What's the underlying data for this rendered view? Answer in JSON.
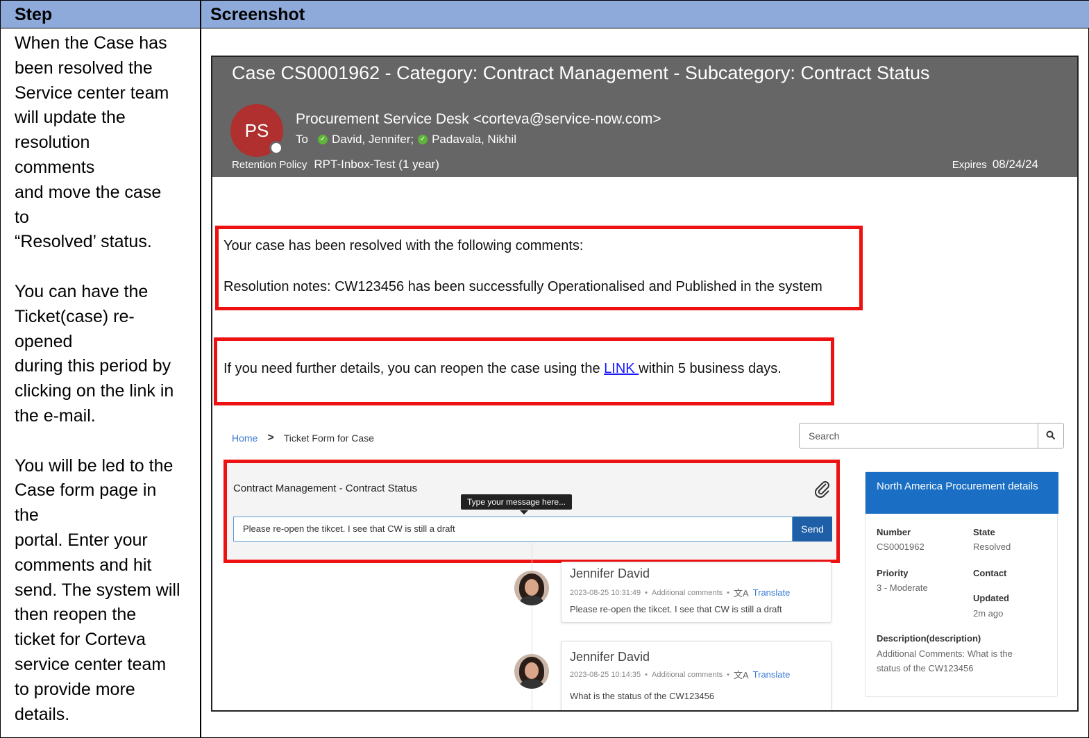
{
  "table": {
    "header_step": "Step",
    "header_screenshot": "Screenshot"
  },
  "step_text": {
    "para1": [
      "When the Case has",
      "been resolved the",
      "Service center team",
      "will update the",
      "resolution",
      "comments",
      "and move the case",
      "to",
      "“Resolved’ status."
    ],
    "para2": [
      "You can have the",
      "Ticket(case) re-",
      "opened",
      "during this period by",
      "clicking on the link in",
      "the e-mail."
    ],
    "para3": [
      "You will be led to the",
      "Case form page in",
      "the",
      "portal. Enter your",
      "comments and hit",
      "send. The system will",
      "then reopen the",
      "ticket for Corteva",
      "service center team",
      "to provide more",
      "details."
    ]
  },
  "email": {
    "subject": "Case CS0001962 - Category: Contract Management - Subcategory: Contract Status",
    "avatar_initials": "PS",
    "sender": "Procurement Service Desk <corteva@service-now.com>",
    "to_label": "To",
    "recipient_1": "David, Jennifer;",
    "recipient_2": "Padavala, Nikhil",
    "retention_label": "Retention Policy",
    "retention_value": "RPT-Inbox-Test (1 year)",
    "expires_label": "Expires",
    "expires_value": "08/24/24",
    "resolved_line": "Your case has been resolved with the following comments:",
    "resolution_notes": "Resolution notes: CW123456 has been successfully Operationalised and Published in the system",
    "reopen_before": "If you need further details, you can reopen the case using the ",
    "reopen_link": "LINK ",
    "reopen_after": "within 5 business days."
  },
  "portal": {
    "breadcrumb_home": "Home",
    "breadcrumb_current": "Ticket Form for Case",
    "search_placeholder": "Search",
    "card_title": "Contract Management - Contract Status",
    "tooltip": "Type your message here...",
    "message_value": "Please re-open the tikcet. I see that CW is still a draft",
    "send_label": "Send",
    "comments": [
      {
        "name": "Jennifer David",
        "timestamp": "2023-08-25 10:31:49",
        "type": "Additional comments",
        "translate": "Translate",
        "text": "Please re-open the tikcet. I see that CW is still a draft"
      },
      {
        "name": "Jennifer David",
        "timestamp": "2023-08-25 10:14:35",
        "type": "Additional comments",
        "translate": "Translate",
        "text": "What is the status of the CW123456"
      }
    ],
    "details": {
      "title": "North America Procurement details",
      "number_label": "Number",
      "number_value": "CS0001962",
      "state_label": "State",
      "state_value": "Resolved",
      "priority_label": "Priority",
      "priority_value": "3 - Moderate",
      "contact_label": "Contact",
      "updated_label": "Updated",
      "updated_value": "2m ago",
      "description_label": "Description(description)",
      "description_line1": "Additional Comments: What is the",
      "description_line2": "status of the CW123456"
    }
  },
  "colors": {
    "header_bg": "#8eaadb",
    "highlight_red": "#ee1111",
    "send_blue": "#1f5fa8",
    "panel_blue": "#1a6fc4"
  }
}
